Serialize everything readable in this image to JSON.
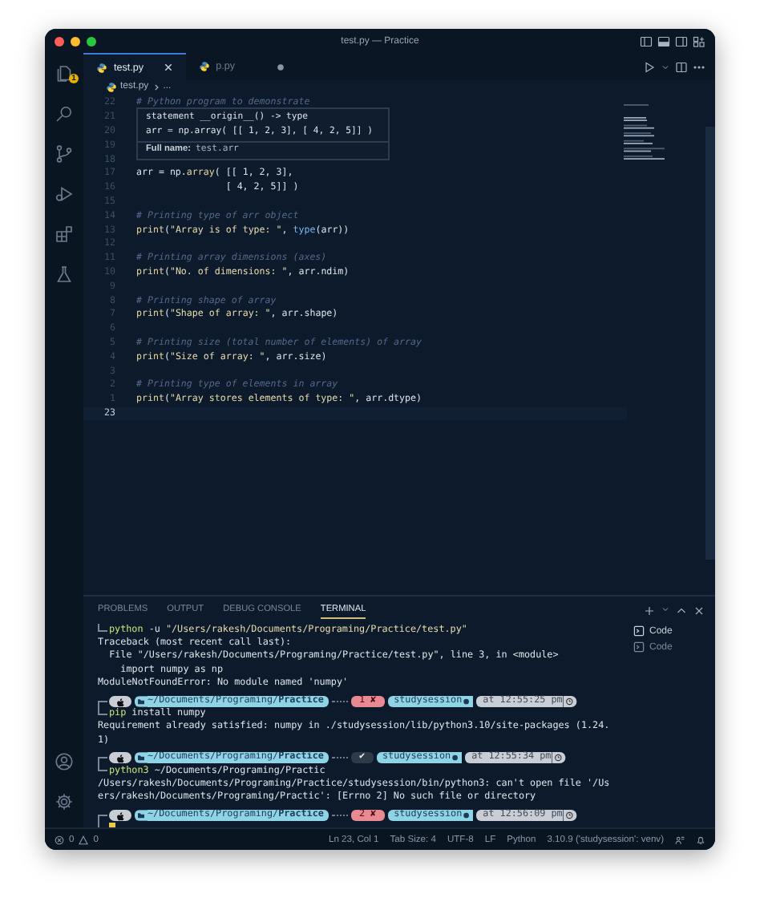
{
  "window": {
    "title": "test.py — Practice"
  },
  "activity_bar": [
    {
      "kind": "files",
      "badge": "1"
    },
    {
      "kind": "search"
    },
    {
      "kind": "scm"
    },
    {
      "kind": "debug"
    },
    {
      "kind": "extensions"
    },
    {
      "kind": "testing"
    }
  ],
  "activity_bar_bottom": [
    {
      "kind": "account"
    },
    {
      "kind": "gear"
    }
  ],
  "tabs": [
    {
      "label": "test.py",
      "selected": true,
      "modified": false
    },
    {
      "label": "p.py",
      "selected": false,
      "modified": true
    }
  ],
  "breadcrumb": [
    "test.py",
    "..."
  ],
  "editor": {
    "lines": [
      {
        "number": "22",
        "current": false,
        "segments": [
          {
            "kind": "comment",
            "text": "# Python program to demonstrate"
          }
        ]
      },
      {
        "number": "21",
        "current": false
      },
      {
        "number": "20",
        "current": false
      },
      {
        "number": "19",
        "current": false
      },
      {
        "number": "18",
        "current": false
      },
      {
        "number": "17",
        "current": false,
        "segments": [
          {
            "kind": "plain",
            "text": "arr = np."
          },
          {
            "kind": "fn",
            "text": "array"
          },
          {
            "kind": "plain",
            "text": "( [[ 1, 2, 3],"
          }
        ]
      },
      {
        "number": "16",
        "current": false,
        "segments": [
          {
            "kind": "plain",
            "text": "                [ 4, 2, 5]] )"
          }
        ]
      },
      {
        "number": "15",
        "current": false
      },
      {
        "number": "14",
        "current": false,
        "segments": [
          {
            "kind": "comment",
            "text": "# Printing type of arr object"
          }
        ]
      },
      {
        "number": "13",
        "current": false,
        "segments": [
          {
            "kind": "fn",
            "text": "print"
          },
          {
            "kind": "plain",
            "text": "("
          },
          {
            "kind": "str",
            "text": "\"Array is of type: \""
          },
          {
            "kind": "plain",
            "text": ", "
          },
          {
            "kind": "builtin",
            "text": "type"
          },
          {
            "kind": "plain",
            "text": "(arr))"
          }
        ]
      },
      {
        "number": "12",
        "current": false
      },
      {
        "number": "11",
        "current": false,
        "segments": [
          {
            "kind": "comment",
            "text": "# Printing array dimensions (axes)"
          }
        ]
      },
      {
        "number": "10",
        "current": false,
        "segments": [
          {
            "kind": "fn",
            "text": "print"
          },
          {
            "kind": "plain",
            "text": "("
          },
          {
            "kind": "str",
            "text": "\"No. of dimensions: \""
          },
          {
            "kind": "plain",
            "text": ", arr.ndim)"
          }
        ]
      },
      {
        "number": "9",
        "current": false
      },
      {
        "number": "8",
        "current": false,
        "segments": [
          {
            "kind": "comment",
            "text": "# Printing shape of array"
          }
        ]
      },
      {
        "number": "7",
        "current": false,
        "segments": [
          {
            "kind": "fn",
            "text": "print"
          },
          {
            "kind": "plain",
            "text": "("
          },
          {
            "kind": "str",
            "text": "\"Shape of array: \""
          },
          {
            "kind": "plain",
            "text": ", arr.shape)"
          }
        ]
      },
      {
        "number": "6",
        "current": false
      },
      {
        "number": "5",
        "current": false,
        "segments": [
          {
            "kind": "comment",
            "text": "# Printing size (total number of elements) of array"
          }
        ]
      },
      {
        "number": "4",
        "current": false,
        "segments": [
          {
            "kind": "fn",
            "text": "print"
          },
          {
            "kind": "plain",
            "text": "("
          },
          {
            "kind": "str",
            "text": "\"Size of array: \""
          },
          {
            "kind": "plain",
            "text": ", arr.size)"
          }
        ]
      },
      {
        "number": "3",
        "current": false
      },
      {
        "number": "2",
        "current": false,
        "segments": [
          {
            "kind": "comment",
            "text": "# Printing type of elements in array"
          }
        ]
      },
      {
        "number": "1",
        "current": false,
        "segments": [
          {
            "kind": "fn",
            "text": "print"
          },
          {
            "kind": "plain",
            "text": "("
          },
          {
            "kind": "str",
            "text": "\"Array stores elements of type: \""
          },
          {
            "kind": "plain",
            "text": ", arr.dtype)"
          }
        ]
      },
      {
        "number": "23",
        "current": true
      }
    ],
    "hover": {
      "lines": [
        "statement __origin__() -> type",
        "arr = np.array( [[ 1, 2, 3], [ 4, 2, 5]] )"
      ],
      "full_name_label": "Full name:",
      "full_name": "test.arr"
    }
  },
  "panel": {
    "tabs": [
      {
        "label": "PROBLEMS",
        "selected": false
      },
      {
        "label": "OUTPUT",
        "selected": false
      },
      {
        "label": "DEBUG CONSOLE",
        "selected": false
      },
      {
        "label": "TERMINAL",
        "selected": true
      }
    ],
    "terminal": {
      "lines": [
        {
          "kind": "command",
          "segments": [
            {
              "kind": "cmd",
              "text": "python"
            },
            {
              "kind": "arg",
              "text": " -u "
            },
            {
              "kind": "str",
              "text": "\"/Users/rakesh/Documents/Programing/Practice/test.py\""
            }
          ]
        },
        {
          "kind": "output",
          "text": "Traceback (most recent call last):"
        },
        {
          "kind": "output",
          "text": "  File \"/Users/rakesh/Documents/Programing/Practice/test.py\", line 3, in <module>"
        },
        {
          "kind": "output",
          "text": "    import numpy as np"
        },
        {
          "kind": "output",
          "text": "ModuleNotFoundError: No module named 'numpy'"
        },
        {
          "kind": "prompt",
          "path": "~/Documents/Programing/**Practice**",
          "status": "1 ✘",
          "color": "#e98a92",
          "env": "studysession",
          "time": "at 12:55:25 pm"
        },
        {
          "kind": "command",
          "segments": [
            {
              "kind": "cmd",
              "text": "pip"
            },
            {
              "kind": "arg",
              "text": " install numpy"
            }
          ]
        },
        {
          "kind": "output",
          "text": "Requirement already satisfied: numpy in ./studysession/lib/python3.10/site-packages (1.24."
        },
        {
          "kind": "output",
          "text": "1)"
        },
        {
          "kind": "prompt",
          "path": "~/Documents/Programing/**Practice**",
          "status": "✔",
          "color": "#2f3a48",
          "env": "studysession",
          "time": "at 12:55:34 pm"
        },
        {
          "kind": "command",
          "segments": [
            {
              "kind": "cmd",
              "text": "python3"
            },
            {
              "kind": "arg",
              "text": " ~/Documents/Programing/Practic"
            }
          ]
        },
        {
          "kind": "output",
          "text": "/Users/rakesh/Documents/Programing/Practice/studysession/bin/python3: can't open file '/Us"
        },
        {
          "kind": "output",
          "text": "ers/rakesh/Documents/Programing/Practic': [Errno 2] No such file or directory"
        },
        {
          "kind": "prompt",
          "path": "~/Documents/Programing/**Practice**",
          "status": "2 ✘",
          "color": "#e98a92",
          "env": "studysession",
          "time": "at 12:56:09 pm"
        },
        {
          "kind": "cursor"
        }
      ]
    },
    "terminals": [
      {
        "label": "Code",
        "selected": true
      },
      {
        "label": "Code",
        "selected": false
      }
    ]
  },
  "status_bar": {
    "errors": "0",
    "warnings": "0",
    "items": [
      "Ln 23, Col 1",
      "Tab Size: 4",
      "UTF-8",
      "LF",
      "Python",
      "3.10.9 ('studysession': venv)"
    ]
  }
}
